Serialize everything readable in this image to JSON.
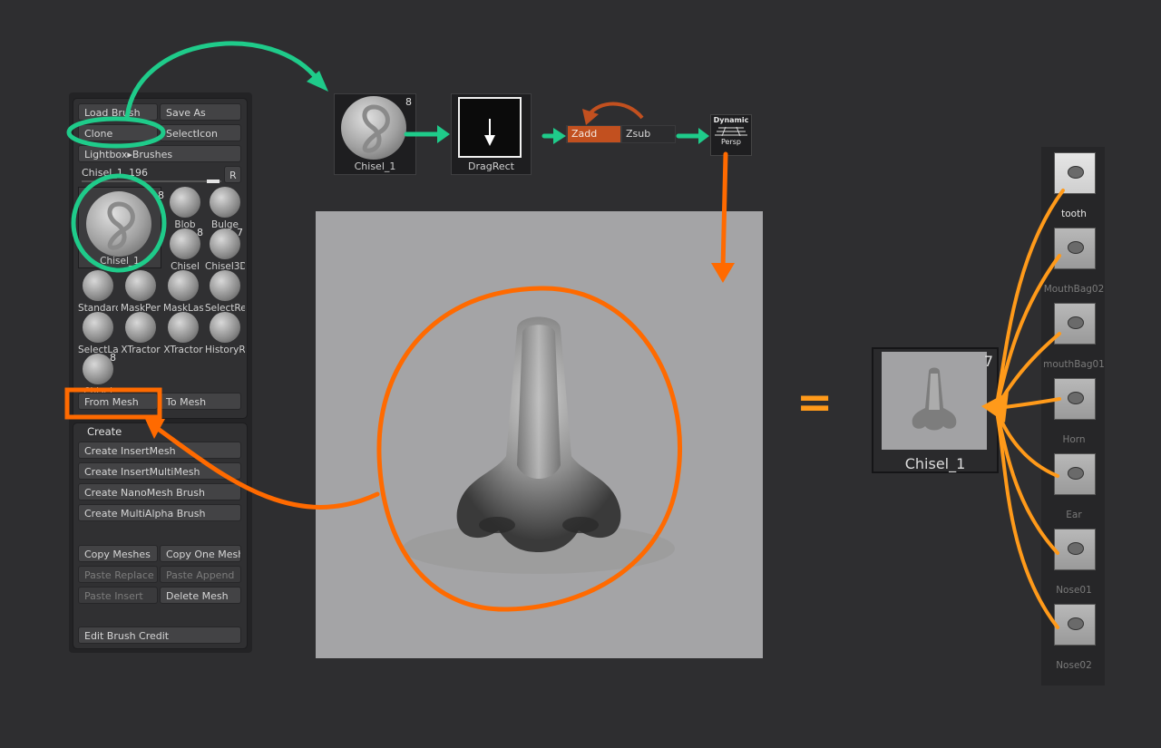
{
  "panel": {
    "load_brush": "Load Brush",
    "save_as": "Save As",
    "clone": "Clone",
    "select_icon": "SelectIcon",
    "lightbox_brushes": "Lightbox▸Brushes",
    "brush_name": "Chisel_1",
    "brush_value": "196",
    "reset": "R",
    "current_brush": {
      "label": "Chisel_1",
      "badge": "8"
    },
    "brushes": [
      {
        "label": "Blob",
        "badge": ""
      },
      {
        "label": "Bulge",
        "badge": ""
      },
      {
        "label": "Chisel",
        "badge": "8"
      },
      {
        "label": "Chisel3D",
        "badge": "7"
      },
      {
        "label": "Standard",
        "badge": ""
      },
      {
        "label": "MaskPen",
        "badge": ""
      },
      {
        "label": "MaskLasso",
        "badge": ""
      },
      {
        "label": "SelectRect",
        "badge": ""
      },
      {
        "label": "SelectLasso",
        "badge": ""
      },
      {
        "label": "XTractor",
        "badge": ""
      },
      {
        "label": "XTractor",
        "badge": ""
      },
      {
        "label": "HistoryRecall",
        "badge": ""
      },
      {
        "label": "Chisel",
        "badge": "8"
      }
    ],
    "from_mesh": "From Mesh",
    "to_mesh": "To Mesh"
  },
  "create": {
    "header": "Create",
    "insert_mesh": "Create InsertMesh",
    "insert_multi_mesh": "Create InsertMultiMesh",
    "nanomesh_brush": "Create NanoMesh Brush",
    "multialpha_brush": "Create MultiAlpha Brush",
    "copy_meshes": "Copy Meshes",
    "copy_one_mesh": "Copy One Mesh",
    "paste_replace": "Paste Replace",
    "paste_append": "Paste Append",
    "paste_insert": "Paste Insert",
    "delete_mesh": "Delete Mesh",
    "edit_brush_credit": "Edit Brush Credit"
  },
  "pipeline": {
    "brush": {
      "label": "Chisel_1",
      "badge": "8"
    },
    "stroke": {
      "label": "DragRect"
    },
    "zadd": "Zadd",
    "zsub": "Zsub",
    "dynamic": "Dynamic",
    "persp": "Persp"
  },
  "result": {
    "label": "Chisel_1",
    "badge": "7",
    "equals": "="
  },
  "shelf": [
    "tooth",
    "MouthBag02",
    "mouthBag01",
    "Horn",
    "Ear",
    "Nose01",
    "Nose02"
  ],
  "colors": {
    "green": "#1fcb8a",
    "orange": "#ff6a00",
    "amber": "#ff9a1a",
    "zadd": "#c2501f"
  }
}
